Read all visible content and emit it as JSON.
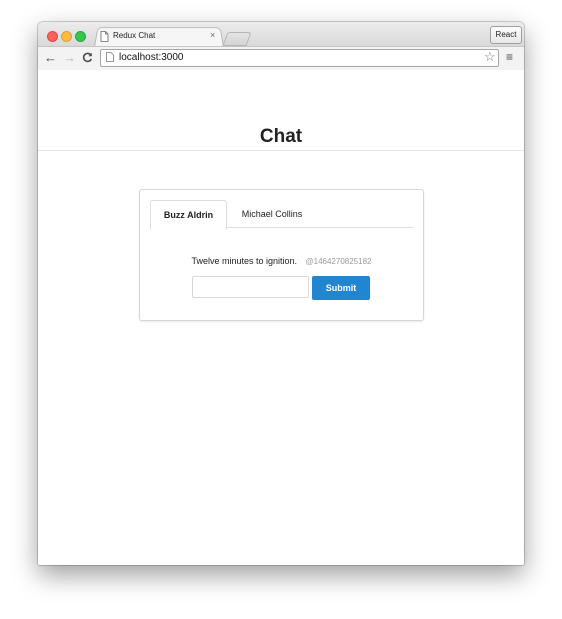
{
  "browser": {
    "tab_title": "Redux Chat",
    "tab_close": "×",
    "profile_label": "React",
    "url": "localhost:3000",
    "nav": {
      "back": "←",
      "forward": "→",
      "reload": "C"
    },
    "star": "☆",
    "menu": "≡",
    "icons": [
      "page-icon",
      "close-icon",
      "back-arrow-icon",
      "forward-arrow-icon",
      "reload-icon",
      "star-icon",
      "hamburger-menu-icon"
    ]
  },
  "page": {
    "title": "Chat",
    "threads": [
      {
        "label": "Buzz Aldrin",
        "active": true
      },
      {
        "label": "Michael Collins",
        "active": false
      }
    ],
    "messages": [
      {
        "text": "Twelve minutes to ignition.",
        "meta": "@1464270825182"
      }
    ],
    "input": {
      "value": "",
      "placeholder": ""
    },
    "submit_label": "Submit"
  },
  "colors": {
    "accent": "#2185d0",
    "meta_text": "#9a9a9a"
  }
}
